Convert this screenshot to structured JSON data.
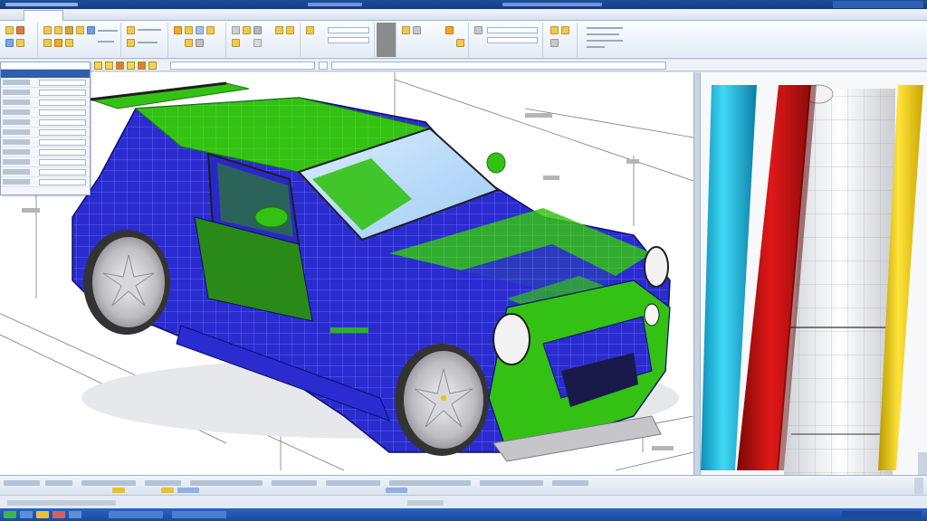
{
  "colors": {
    "car_body_blue": "#2a2ccf",
    "car_accent_green": "#33c214",
    "tire_gray": "#c9c9cc",
    "cyan_bar": "#22c4e6",
    "red_bar": "#c41212",
    "yellow_bar": "#f1cf10",
    "title_bar_blue": "#1d4e9a"
  },
  "icons": {
    "ribbon": [
      "toolbar-icon"
    ],
    "taskbar": [
      "start-icon",
      "app-icon"
    ],
    "panel": [
      "property-panel-icon"
    ]
  }
}
